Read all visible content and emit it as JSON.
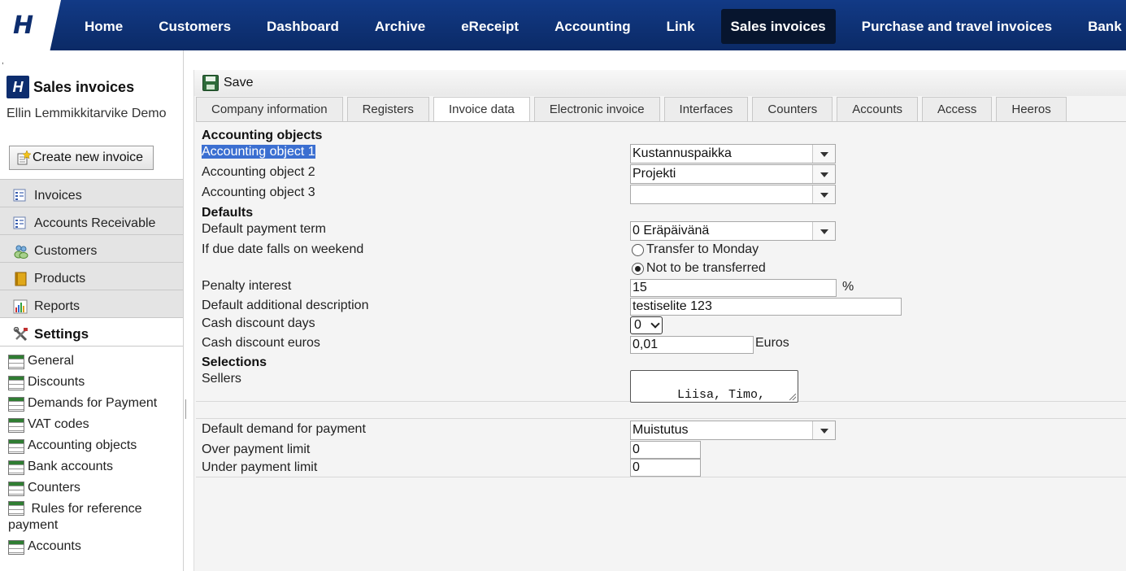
{
  "nav": {
    "logo": "H",
    "items": [
      "Home",
      "Customers",
      "Dashboard",
      "Archive",
      "eReceipt",
      "Accounting",
      "Link",
      "Sales invoices",
      "Purchase and travel invoices",
      "Bank"
    ]
  },
  "sidebar": {
    "tick": ",",
    "brand_icon": "H",
    "brand_title": "Sales invoices",
    "company": "Ellin Lemmikkitarvike Demo",
    "create_label": "Create new invoice",
    "menu": [
      "Invoices",
      "Accounts Receivable",
      "Customers",
      "Products",
      "Reports"
    ],
    "settings_label": "Settings",
    "settings_items": [
      "General",
      "Discounts",
      "Demands for Payment",
      "VAT codes",
      "Accounting objects",
      "Bank accounts",
      "Counters",
      "Rules for reference payment",
      "Accounts"
    ]
  },
  "toolbar": {
    "save_label": "Save"
  },
  "tabs": [
    "Company information",
    "Registers",
    "Invoice data",
    "Electronic invoice",
    "Interfaces",
    "Counters",
    "Accounts",
    "Access",
    "Heeros"
  ],
  "form": {
    "accounting_objects_header": "Accounting objects",
    "ao1_label": "Accounting object 1",
    "ao1_value": "Kustannuspaikka",
    "ao2_label": "Accounting object 2",
    "ao2_value": "Projekti",
    "ao3_label": "Accounting object 3",
    "ao3_value": "",
    "defaults_header": "Defaults",
    "payment_term_label": "Default payment term",
    "payment_term_value": "0 Eräpäivänä",
    "weekend_label": "If due date falls on weekend",
    "weekend_option1": "Transfer to Monday",
    "weekend_option2": "Not to be transferred",
    "penalty_label": "Penalty interest",
    "penalty_value": "15",
    "penalty_suffix": "%",
    "add_desc_label": "Default additional description",
    "add_desc_value": "testiselite 123",
    "cash_days_label": "Cash discount days",
    "cash_days_value": "0",
    "cash_euros_label": "Cash discount euros",
    "cash_euros_value": "0,01",
    "cash_euros_suffix": "Euros",
    "selections_header": "Selections",
    "sellers_label": "Sellers",
    "sellers_value": "Liisa, Timo, Niina,\nElli",
    "demand_label": "Default demand for payment",
    "demand_value": "Muistutus",
    "over_label": "Over payment limit",
    "over_value": "0",
    "under_label": "Under payment limit",
    "under_value": "0"
  }
}
